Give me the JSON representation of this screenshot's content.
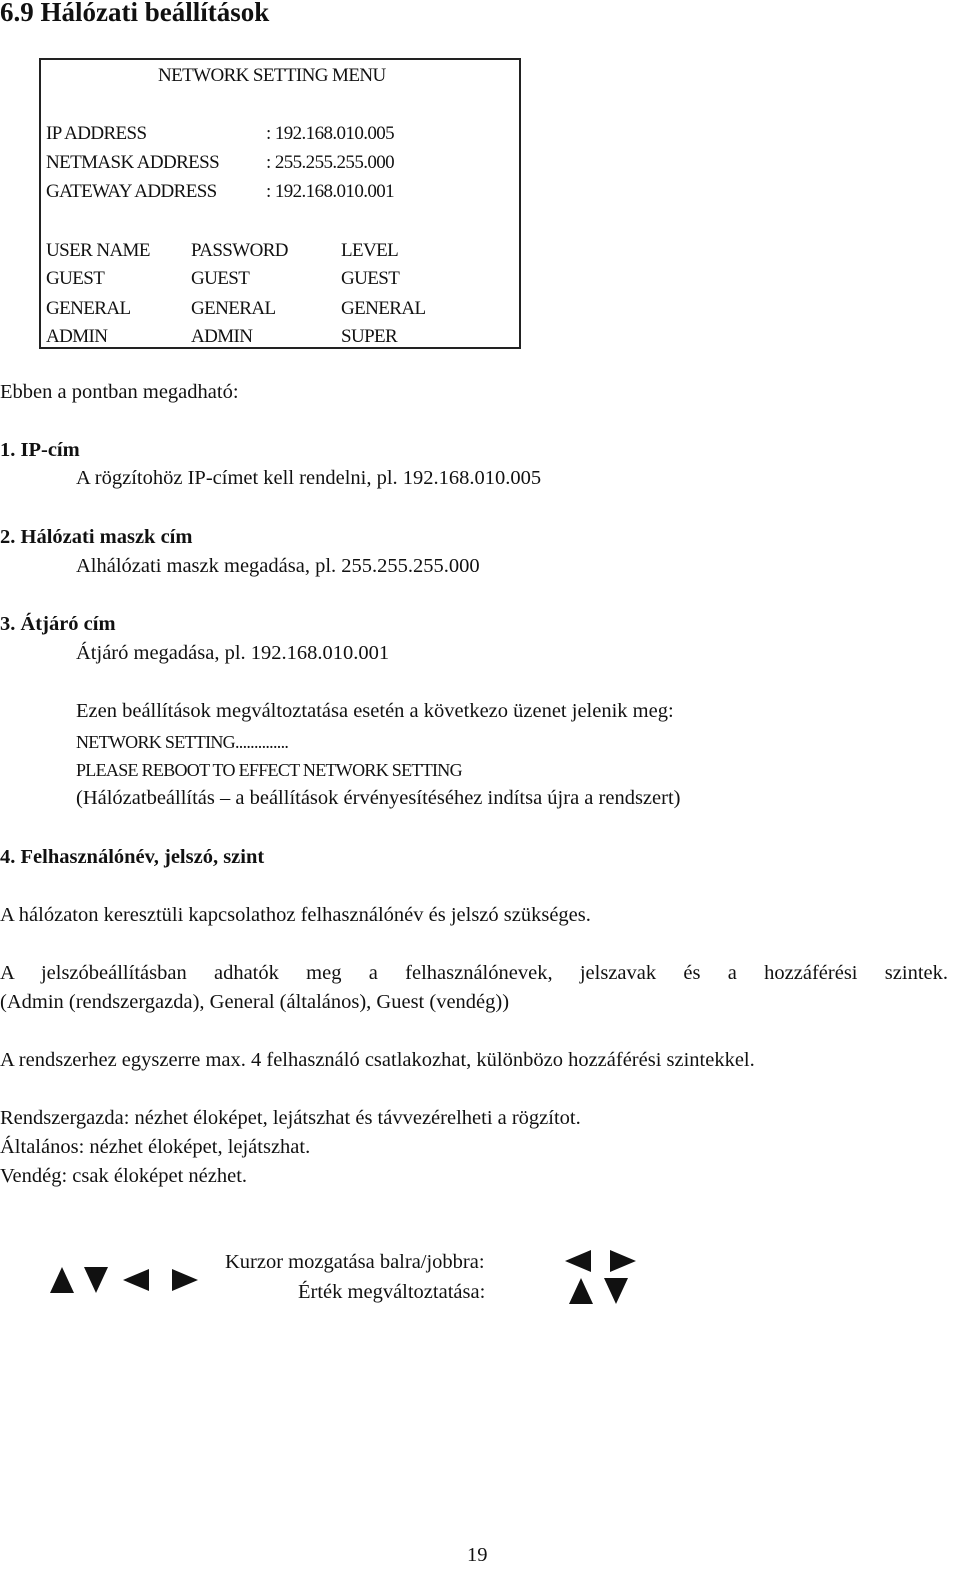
{
  "heading": "6.9 Hálózati beállítások",
  "menu": {
    "title": "NETWORK SETTING MENU",
    "addresses": [
      {
        "label": "IP ADDRESS",
        "value": ": 192.168.010.005"
      },
      {
        "label": "NETMASK ADDRESS",
        "value": ": 255.255.255.000"
      },
      {
        "label": "GATEWAY ADDRESS",
        "value": ": 192.168.010.001"
      }
    ],
    "users_header": [
      "USER NAME",
      "PASSWORD",
      "LEVEL"
    ],
    "users": [
      [
        "GUEST",
        "GUEST",
        "GUEST"
      ],
      [
        "GENERAL",
        "GENERAL",
        "GENERAL"
      ],
      [
        "ADMIN",
        "ADMIN",
        "SUPER"
      ]
    ]
  },
  "intro": "Ebben a pontban megadható:",
  "items": [
    {
      "title": "1. IP-cím",
      "desc": "A rögzítohöz IP-címet kell rendelni, pl. 192.168.010.005"
    },
    {
      "title": "2. Hálózati maszk cím",
      "desc": "Alhálózati maszk megadása, pl. 255.255.255.000"
    },
    {
      "title": "3. Átjáró cím",
      "desc": "Átjáró megadása, pl. 192.168.010.001"
    }
  ],
  "change_notice": {
    "intro": "Ezen beállítások megváltoztatása esetén a következo üzenet jelenik meg:",
    "msg1": "NETWORK SETTING..............",
    "msg2": "PLEASE REBOOT TO EFFECT NETWORK SETTING",
    "translation": "(Hálózatbeállítás – a beállítások érvényesítéséhez indítsa újra a rendszert)"
  },
  "section4": {
    "title": "4. Felhasználónév, jelszó, szint",
    "p1": "A hálózaton keresztüli kapcsolathoz felhasználónév és jelszó szükséges.",
    "p2a": "A jelszóbeállításban adhatók meg a felhasználónevek, jelszavak és a hozzáférési szintek.",
    "p2b": "(Admin (rendszergazda), General (általános), Guest (vendég))",
    "p3": "A rendszerhez egyszerre max. 4 felhasználó csatlakozhat, különbözo hozzáférési szintekkel.",
    "roles": [
      "Rendszergazda: nézhet éloképet, lejátszhat és távvezérelheti a rögzítot.",
      "Általános: nézhet éloképet, lejátszhat.",
      "Vendég: csak éloképet nézhet."
    ]
  },
  "controls": {
    "cursor_label": "Kurzor mozgatása balra/jobbra:",
    "value_label": "Érték megváltoztatása:"
  },
  "page_number": "19"
}
